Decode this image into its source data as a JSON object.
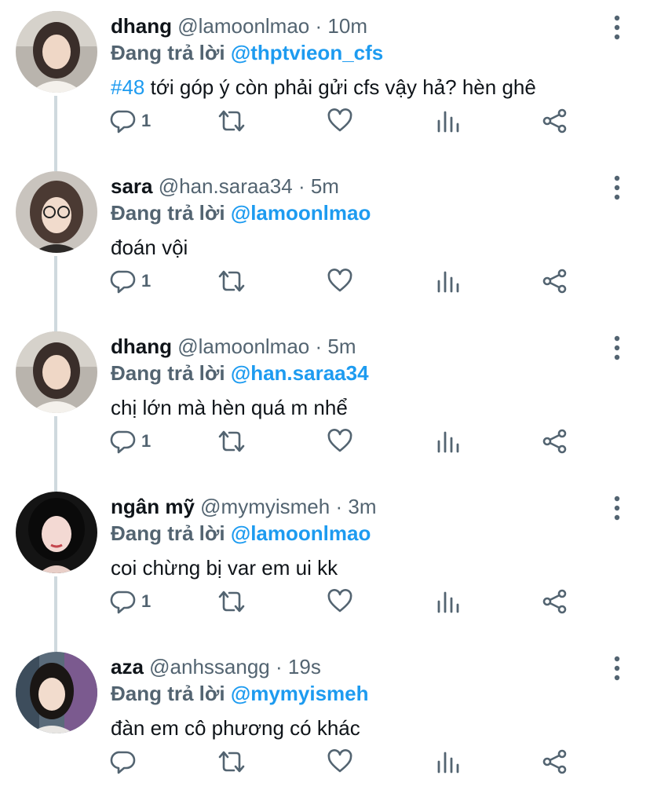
{
  "thread": {
    "tweets": [
      {
        "display_name": "dhang",
        "handle": "@lamoonlmao",
        "separator": "·",
        "time": "10m",
        "replying_label": "Đang trả lời",
        "replying_to": "@thptvieon_cfs",
        "hashtag": "#48",
        "text": " tới góp ý còn phải gửi cfs vậy hả? hèn ghê",
        "reply_count": "1"
      },
      {
        "display_name": "sara",
        "handle": "@han.saraa34",
        "separator": "·",
        "time": "5m",
        "replying_label": "Đang trả lời",
        "replying_to": "@lamoonlmao",
        "hashtag": "",
        "text": "đoán vội",
        "reply_count": "1"
      },
      {
        "display_name": "dhang",
        "handle": "@lamoonlmao",
        "separator": "·",
        "time": "5m",
        "replying_label": "Đang trả lời",
        "replying_to": "@han.saraa34",
        "hashtag": "",
        "text": "chị lớn mà hèn quá m nhể",
        "reply_count": "1"
      },
      {
        "display_name": "ngân mỹ",
        "handle": "@mymyismeh",
        "separator": "·",
        "time": "3m",
        "replying_label": "Đang trả lời",
        "replying_to": "@lamoonlmao",
        "hashtag": "",
        "text": "coi chừng bị var em ui kk",
        "reply_count": "1"
      },
      {
        "display_name": "aza",
        "handle": "@anhssangg",
        "separator": "·",
        "time": "19s",
        "replying_label": "Đang trả lời",
        "replying_to": "@mymyismeh",
        "hashtag": "",
        "text": "đàn em cô phương có khác",
        "reply_count": ""
      }
    ]
  },
  "icons": {
    "reply": "reply-icon",
    "retweet": "retweet-icon",
    "like": "heart-icon",
    "views": "analytics-icon",
    "share": "share-icon",
    "more": "more-options-icon"
  },
  "colors": {
    "accent": "#1d9bf0",
    "muted": "#536471",
    "text": "#0f1419",
    "thread_line": "#cfd9de"
  }
}
